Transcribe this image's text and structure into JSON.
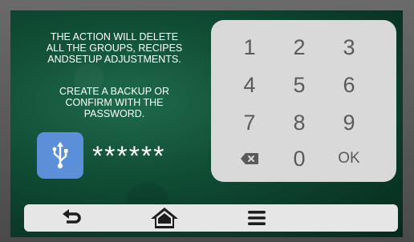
{
  "warning": {
    "line1": "THE ACTION WILL DELETE",
    "line2": "ALL THE GROUPS, RECIPES",
    "line3": "ANDSETUP ADJUSTMENTS.",
    "line4": "CREATE A BACKUP  OR",
    "line5": "CONFIRM  WITH THE",
    "line6": "PASSWORD."
  },
  "password": {
    "masked_value": "******"
  },
  "keypad": {
    "k1": "1",
    "k2": "2",
    "k3": "3",
    "k4": "4",
    "k5": "5",
    "k6": "6",
    "k7": "7",
    "k8": "8",
    "k9": "9",
    "k0": "0",
    "ok": "OK"
  },
  "icons": {
    "usb": "usb-icon",
    "backspace": "backspace-icon",
    "back": "back-arrow-icon",
    "home": "home-icon",
    "menu": "menu-icon"
  },
  "colors": {
    "background": "#0f4a33",
    "usb_button": "#5b8fd8",
    "keypad": "#d9d9d9",
    "key_text": "#5a5a5a",
    "bottom_bar": "#e6e6e6",
    "nav_icon": "#1e1e1e"
  }
}
